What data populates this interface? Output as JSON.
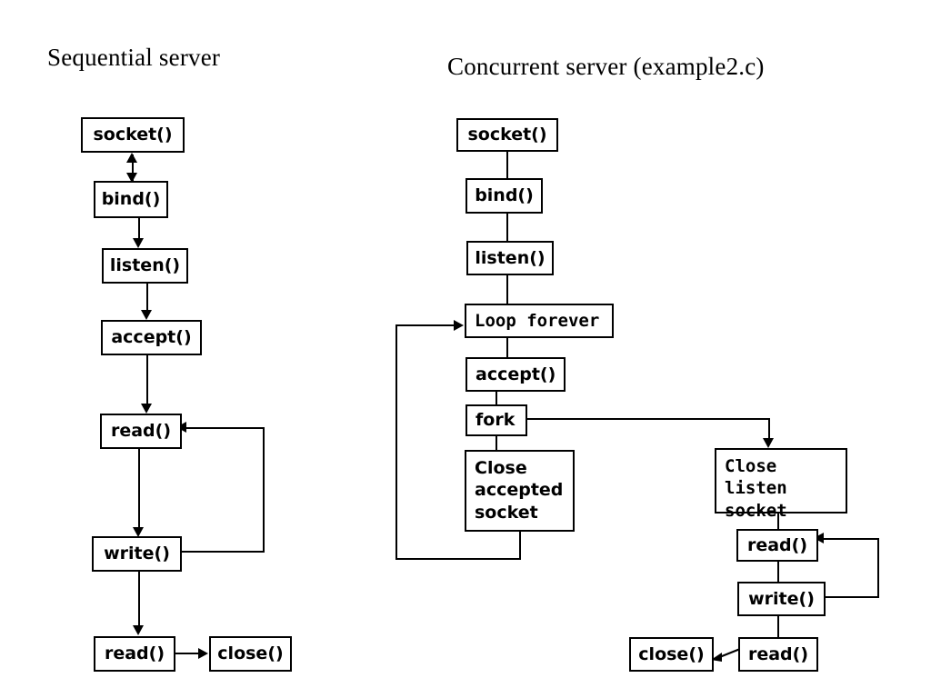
{
  "diagram": {
    "kind": "flowchart",
    "background_color": "#ffffff",
    "line_color": "#000000",
    "box_fill_color": "#ffffff",
    "panels": [
      {
        "id": "sequential",
        "title": "Sequential server",
        "nodes": [
          {
            "id": "seq-socket",
            "label": "socket()"
          },
          {
            "id": "seq-bind",
            "label": "bind()"
          },
          {
            "id": "seq-listen",
            "label": "listen()"
          },
          {
            "id": "seq-accept",
            "label": "accept()"
          },
          {
            "id": "seq-read",
            "label": "read()"
          },
          {
            "id": "seq-write",
            "label": "write()"
          },
          {
            "id": "seq-read2",
            "label": "read()"
          },
          {
            "id": "seq-close",
            "label": "close()"
          }
        ],
        "edges": [
          {
            "from": "seq-socket",
            "to": "seq-bind",
            "style": "double-arrow-vertical"
          },
          {
            "from": "seq-bind",
            "to": "seq-listen",
            "style": "arrow-down"
          },
          {
            "from": "seq-listen",
            "to": "seq-accept",
            "style": "arrow-down"
          },
          {
            "from": "seq-accept",
            "to": "seq-read",
            "style": "arrow-down"
          },
          {
            "from": "seq-read",
            "to": "seq-write",
            "style": "arrow-down"
          },
          {
            "from": "seq-write",
            "to": "seq-read",
            "style": "loop-back-right"
          },
          {
            "from": "seq-write",
            "to": "seq-read2",
            "style": "arrow-down"
          },
          {
            "from": "seq-read2",
            "to": "seq-close",
            "style": "arrow-right"
          }
        ]
      },
      {
        "id": "concurrent",
        "title": "Concurrent server (example2.c)",
        "nodes": [
          {
            "id": "con-socket",
            "label": "socket()"
          },
          {
            "id": "con-bind",
            "label": "bind()"
          },
          {
            "id": "con-listen",
            "label": "listen()"
          },
          {
            "id": "con-loop",
            "label": "Loop forever"
          },
          {
            "id": "con-accept",
            "label": "accept()"
          },
          {
            "id": "con-fork",
            "label": "fork"
          },
          {
            "id": "con-close-acc",
            "label": "Close\naccepted\nsocket"
          },
          {
            "id": "con-close-listen",
            "label": "Close listen\nsocket"
          },
          {
            "id": "con-read",
            "label": "read()"
          },
          {
            "id": "con-write",
            "label": "write()"
          },
          {
            "id": "con-read2",
            "label": "read()"
          },
          {
            "id": "con-close",
            "label": "close()"
          }
        ],
        "edges": [
          {
            "from": "con-socket",
            "to": "con-bind",
            "style": "line"
          },
          {
            "from": "con-bind",
            "to": "con-listen",
            "style": "line"
          },
          {
            "from": "con-listen",
            "to": "con-loop",
            "style": "line"
          },
          {
            "from": "con-loop",
            "to": "con-accept",
            "style": "line"
          },
          {
            "from": "con-accept",
            "to": "con-fork",
            "style": "line"
          },
          {
            "from": "con-fork",
            "to": "con-close-acc",
            "style": "line"
          },
          {
            "from": "con-close-acc",
            "to": "con-loop",
            "style": "loop-back-left-arrow"
          },
          {
            "from": "con-fork",
            "to": "con-close-listen",
            "style": "branch-right-arrow-down"
          },
          {
            "from": "con-close-listen",
            "to": "con-read",
            "style": "line"
          },
          {
            "from": "con-read",
            "to": "con-write",
            "style": "line"
          },
          {
            "from": "con-write",
            "to": "con-read",
            "style": "loop-back-right"
          },
          {
            "from": "con-write",
            "to": "con-read2",
            "style": "line"
          },
          {
            "from": "con-read2",
            "to": "con-close",
            "style": "diagonal-arrow-left"
          }
        ]
      }
    ]
  }
}
